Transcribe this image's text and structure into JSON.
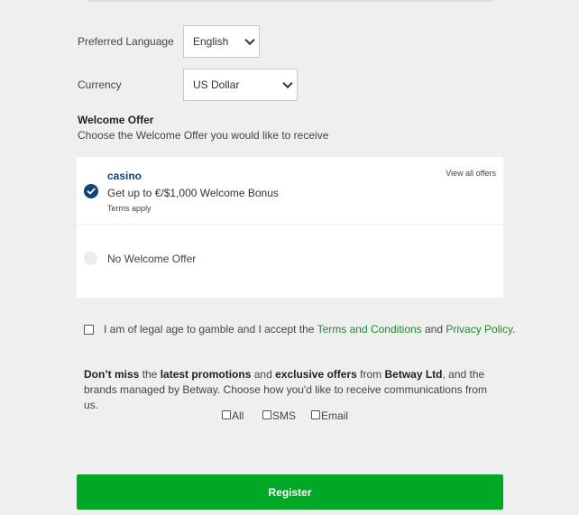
{
  "language": {
    "label": "Preferred Language",
    "value": "English"
  },
  "currency": {
    "label": "Currency",
    "value": "US Dollar"
  },
  "welcome_offer": {
    "title": "Welcome Offer",
    "subtitle": "Choose the Welcome Offer you would like to receive",
    "offers": [
      {
        "name": "casino",
        "description": "Get up to €/$1,000 Welcome Bonus",
        "terms": "Terms apply",
        "view_all": "View all offers",
        "selected": true
      },
      {
        "name": "No Welcome Offer",
        "selected": false
      }
    ]
  },
  "legal": {
    "text_before": "I am of legal age to gamble and I accept the ",
    "terms_link": "Terms and Conditions",
    "text_and": " and ",
    "privacy_link": "Privacy Policy",
    "text_after": "."
  },
  "promotions": {
    "p1": "Don’t miss",
    "p2": " the ",
    "p3": "latest promotions",
    "p4": " and ",
    "p5": "exclusive offers",
    "p6": " from ",
    "p7": "Betway Ltd",
    "p8": ", and the brands managed by Betway. Choose how you'd like to receive communications from us."
  },
  "communication": {
    "all": "All",
    "sms": "SMS",
    "email": "Email"
  },
  "register_label": "Register",
  "colors": {
    "accent_green": "#00a826",
    "link_green": "#1e8a2c",
    "brand_blue": "#12427a"
  }
}
